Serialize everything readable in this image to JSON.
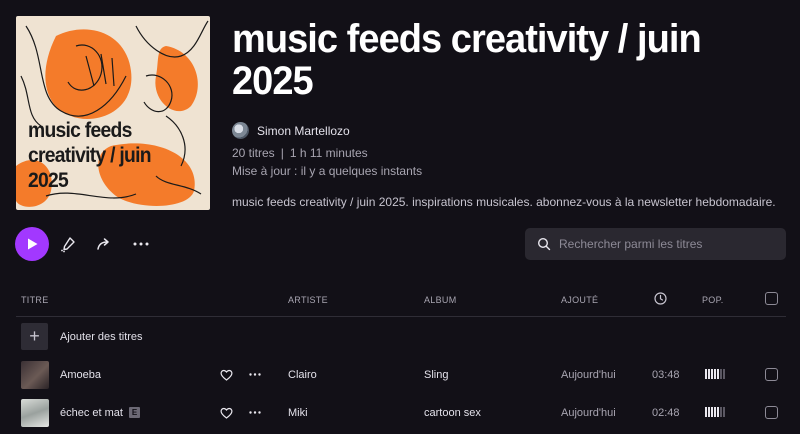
{
  "playlist": {
    "cover_lines": [
      "music feeds",
      "creativity / juin",
      "2025"
    ],
    "title": "music feeds creativity / juin 2025",
    "owner": "Simon Martellozo",
    "track_count": "20 titres",
    "separator": "|",
    "duration": "1 h 11 minutes",
    "updated": "Mise à jour : il y a quelques instants",
    "description": "music feeds creativity / juin 2025. inspirations musicales. abonnez-vous à la newsletter hebdomadaire."
  },
  "toolbar": {
    "play_icon": "play-icon",
    "edit_icon": "edit-icon",
    "share_icon": "share-icon",
    "more_icon": "more-icon",
    "search_placeholder": "Rechercher parmi les titres"
  },
  "table": {
    "headers": {
      "title": "TITRE",
      "artist": "ARTISTE",
      "album": "ALBUM",
      "added": "AJOUTÉ",
      "duration_icon": "clock-icon",
      "popularity": "POP."
    },
    "add_label": "Ajouter des titres",
    "rows": [
      {
        "title": "Amoeba",
        "explicit": false,
        "artist": "Clairo",
        "album": "Sling",
        "added": "Aujourd'hui",
        "duration": "03:48",
        "popularity": 0.6
      },
      {
        "title": "échec et mat",
        "explicit": true,
        "explicit_label": "E",
        "artist": "Miki",
        "album": "cartoon sex",
        "added": "Aujourd'hui",
        "duration": "02:48",
        "popularity": 0.6
      }
    ]
  },
  "colors": {
    "accent": "#a238ff",
    "background": "#121017",
    "cover_orange": "#f47b2a"
  }
}
